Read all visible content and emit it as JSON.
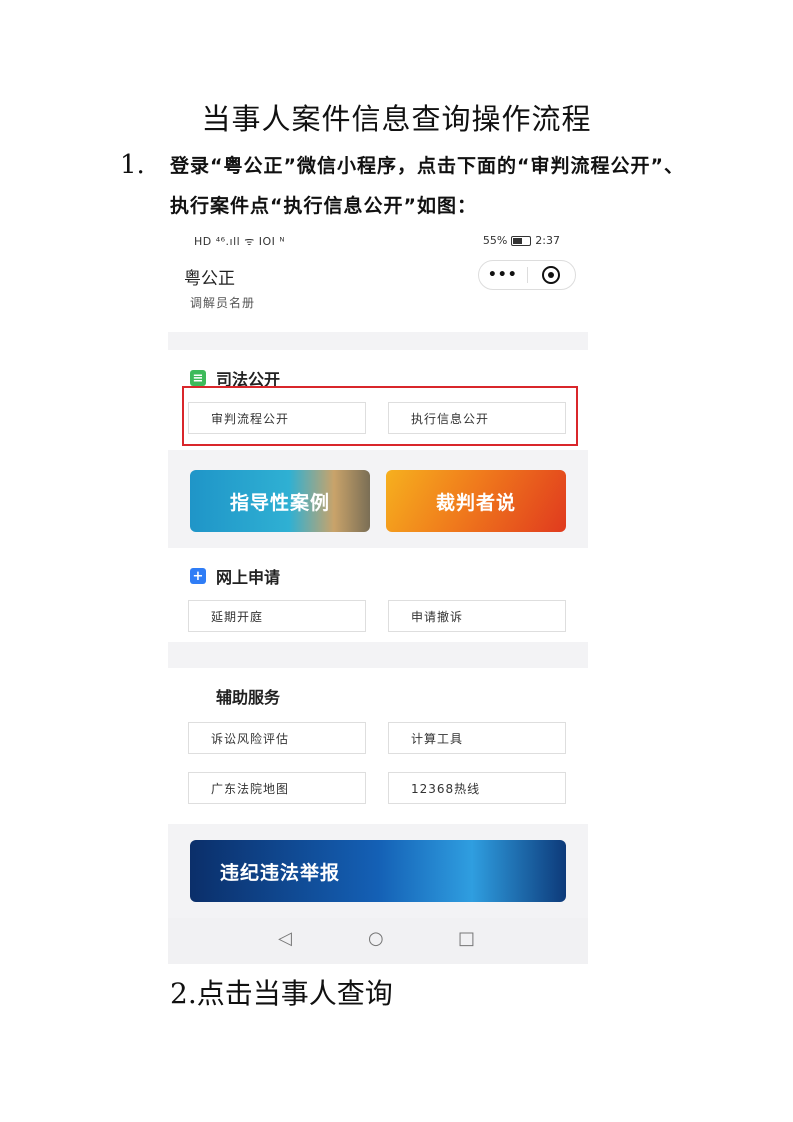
{
  "document": {
    "title": "当事人案件信息查询操作流程",
    "step1": {
      "number": "1.",
      "text": "登录“粤公正”微信小程序，点击下面的“审判流程公开”、执行案件点“执行信息公开”如图："
    },
    "step2": {
      "text": "2.点击当事人查询"
    }
  },
  "phone": {
    "status_bar": {
      "left": "HD ⁴⁶.ıll ᯤ ΙΟΙ ᴺ",
      "battery": "55%",
      "time": "2:37"
    },
    "header": {
      "app_name": "粤公正",
      "subtitle": "调解员名册",
      "more_icon": "•••"
    },
    "judicial": {
      "title": "司法公开",
      "buttons": [
        "审判流程公开",
        "执行信息公开"
      ]
    },
    "banners": [
      "指导性案例",
      "裁判者说"
    ],
    "online": {
      "title": "网上申请",
      "buttons": [
        "延期开庭",
        "申请撤诉"
      ]
    },
    "services": {
      "title": "辅助服务",
      "buttons": [
        "诉讼风险评估",
        "计算工具",
        "广东法院地图",
        "12368热线"
      ]
    },
    "report_banner": "违纪违法举报",
    "nav": {
      "back": "◁",
      "home": "○",
      "recent": "□"
    },
    "colors": {
      "highlight": "#d9262b",
      "green": "#3dba5a",
      "blue": "#2f7df6",
      "red": "#e23a33"
    }
  }
}
